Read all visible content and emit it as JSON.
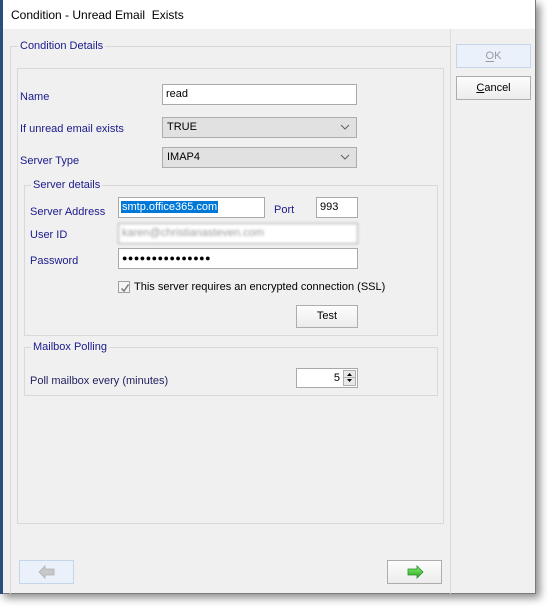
{
  "window": {
    "title": "Condition - Unread Email  Exists"
  },
  "condition_details": {
    "legend": "Condition Details",
    "name_label": "Name",
    "name_value": "read",
    "unread_label": "If unread email exists",
    "unread_value": "TRUE",
    "server_type_label": "Server Type",
    "server_type_value": "IMAP4"
  },
  "server_details": {
    "legend": "Server details",
    "address_label": "Server Address",
    "address_value": "smtp.office365.com",
    "port_label": "Port",
    "port_value": "993",
    "userid_label": "User ID",
    "userid_value": "karen@christianasteven.com",
    "password_label": "Password",
    "password_value": "●●●●●●●●●●●●●●●",
    "ssl_label": "This server requires an encrypted connection (SSL)",
    "ssl_checked": true,
    "test_label": "Test"
  },
  "mailbox_polling": {
    "legend": "Mailbox Polling",
    "poll_label": "Poll mailbox every (minutes)",
    "poll_value": "5"
  },
  "actions": {
    "ok_label": "OK",
    "cancel_label": "Cancel",
    "back_enabled": false,
    "next_enabled": true
  },
  "colors": {
    "label_text": "#1a1a8c",
    "selection": "#0078d7",
    "next_arrow": "#3cc83c"
  }
}
